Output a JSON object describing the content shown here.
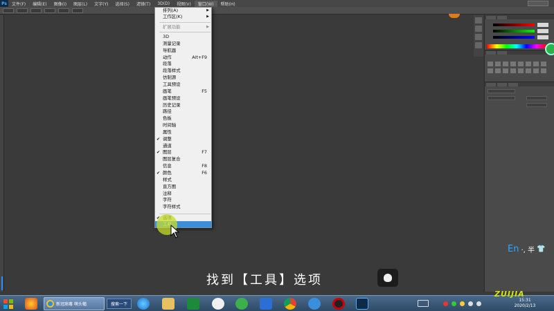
{
  "menubar": {
    "logo": "Ps",
    "items": [
      "文件(F)",
      "编辑(E)",
      "图像(I)",
      "图层(L)",
      "文字(Y)",
      "选择(S)",
      "滤镜(T)",
      "3D(D)",
      "视图(V)",
      "窗口(W)",
      "帮助(H)"
    ],
    "active": "窗口(W)"
  },
  "window_menu": {
    "arrange": "排列(A)",
    "workspace": "工作区(K)",
    "extensions": "扩展功能",
    "panels": [
      {
        "label": "3D"
      },
      {
        "label": "测量记录"
      },
      {
        "label": "导航器"
      },
      {
        "label": "动作",
        "shortcut": "Alt+F9"
      },
      {
        "label": "段落"
      },
      {
        "label": "段落样式"
      },
      {
        "label": "仿制源"
      },
      {
        "label": "工具预设"
      },
      {
        "label": "画笔",
        "shortcut": "F5"
      },
      {
        "label": "画笔预设"
      },
      {
        "label": "历史记录"
      },
      {
        "label": "路径"
      },
      {
        "label": "色板"
      },
      {
        "label": "时间轴"
      },
      {
        "label": "属性"
      },
      {
        "label": "调整",
        "checked": true
      },
      {
        "label": "通道"
      },
      {
        "label": "图层",
        "shortcut": "F7",
        "checked": true
      },
      {
        "label": "图层复合"
      },
      {
        "label": "信息",
        "shortcut": "F8"
      },
      {
        "label": "颜色",
        "shortcut": "F6",
        "checked": true
      },
      {
        "label": "样式"
      },
      {
        "label": "直方图"
      },
      {
        "label": "注释"
      },
      {
        "label": "字符"
      },
      {
        "label": "字符样式"
      }
    ],
    "options": "选项",
    "tools": "工具"
  },
  "subtitle": "找到【工具】选项",
  "ime": {
    "label": "En",
    "extra": "·, 半"
  },
  "taskbar": {
    "ie_window": "新冠病毒 萌头幅",
    "search_button": "搜索一下",
    "clock_time": "15:31",
    "clock_date": "2020/2/13"
  },
  "watermark": "ZUIJIA",
  "colors": {
    "menu_highlight": "#3a8fdc",
    "ime_blue": "#29a7ff",
    "click_circle": "#c8dc28"
  }
}
